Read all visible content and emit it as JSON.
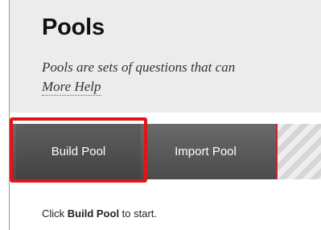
{
  "header": {
    "title": "Pools",
    "description": "Pools are sets of questions that can",
    "help_link": "More Help"
  },
  "action_bar": {
    "build_pool_label": "Build Pool",
    "import_pool_label": "Import Pool"
  },
  "hint": {
    "prefix": "Click ",
    "emphasis": "Build Pool",
    "suffix": " to start."
  },
  "colors": {
    "highlight_border": "#e2141b",
    "bar_accent": "#c3272b",
    "header_bg": "#ececec",
    "bar_bg": "#555555"
  }
}
